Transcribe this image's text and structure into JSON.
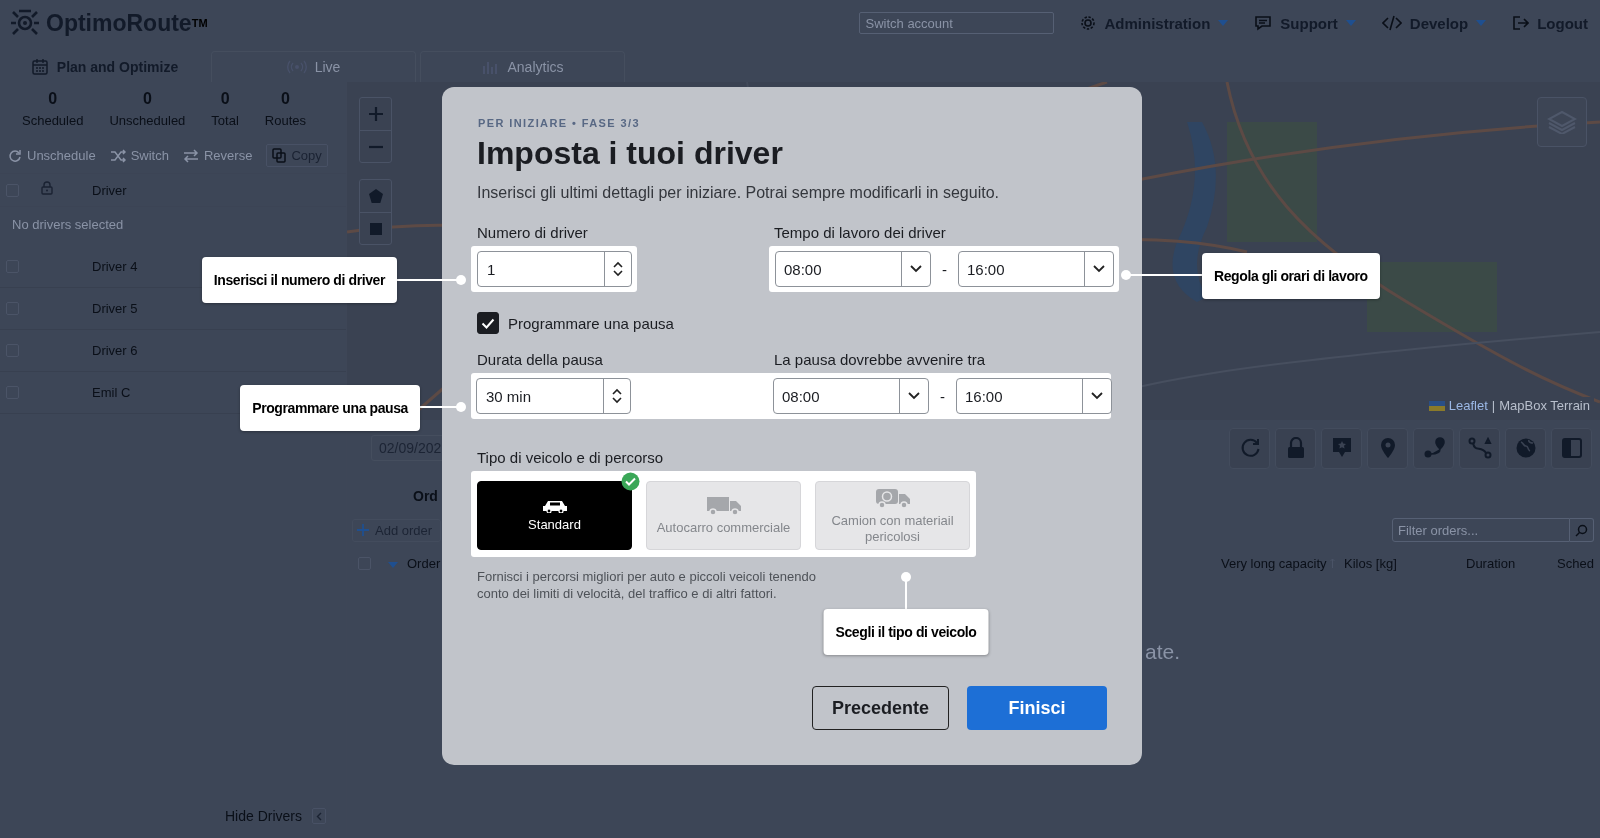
{
  "app": {
    "logo": "OptimoRoute",
    "trademark": "TM",
    "switch_account": {
      "placeholder": "Switch account"
    },
    "nav": [
      {
        "label": "Administration",
        "dropdown": true
      },
      {
        "label": "Support",
        "dropdown": true
      },
      {
        "label": "Develop",
        "dropdown": true
      },
      {
        "label": "Logout",
        "dropdown": false
      }
    ]
  },
  "tabs": [
    {
      "label": "Plan and Optimize",
      "selected": true
    },
    {
      "label": "Live",
      "selected": false
    },
    {
      "label": "Analytics",
      "selected": false
    }
  ],
  "stats": [
    {
      "value": "0",
      "label": "Scheduled"
    },
    {
      "value": "0",
      "label": "Unscheduled"
    },
    {
      "value": "0",
      "label": "Total"
    },
    {
      "value": "0",
      "label": "Routes"
    }
  ],
  "toolbar": [
    {
      "label": "Unschedule",
      "disabled": true
    },
    {
      "label": "Switch",
      "disabled": true
    },
    {
      "label": "Reverse",
      "disabled": true
    },
    {
      "label": "Copy",
      "disabled": false
    }
  ],
  "drivers": {
    "column": "Driver",
    "select_all_checked": false,
    "empty_message": "No drivers selected",
    "rows": [
      {
        "name": "Driver 4",
        "checked": false
      },
      {
        "name": "Driver 5",
        "checked": false
      },
      {
        "name": "Driver 6",
        "checked": false
      },
      {
        "name": "Emil C",
        "checked": false
      }
    ],
    "hide_label": "Hide Drivers"
  },
  "map": {
    "attribution_link": "Leaflet",
    "attribution_separator": "|",
    "attribution_text": "MapBox Terrain"
  },
  "orders": {
    "date": "02/09/202",
    "title": "Ord",
    "add_button": "Add order",
    "filter": {
      "placeholder": "Filter orders..."
    },
    "select_all_checked": false,
    "columns": [
      "Order",
      "Very long capacity",
      "Kilos [kg]",
      "Duration",
      "Sched"
    ],
    "empty_text": "ate."
  },
  "dialog": {
    "step": "PER INIZIARE • FASE 3/3",
    "title": "Imposta i tuoi driver",
    "subtitle": "Inserisci gli ultimi dettagli per iniziare. Potrai sempre modificarli in seguito.",
    "driver_count": {
      "label": "Numero di driver",
      "value": "1"
    },
    "work_time": {
      "label": "Tempo di lavoro dei driver",
      "from": "08:00",
      "separator": "-",
      "to": "16:00"
    },
    "break_option": {
      "label": "Programmare una pausa",
      "checked": true
    },
    "break_duration": {
      "label": "Durata della pausa",
      "value": "30 min"
    },
    "break_window": {
      "label": "La pausa dovrebbe avvenire tra",
      "from": "08:00",
      "separator": "-",
      "to": "16:00"
    },
    "vehicle": {
      "label": "Tipo di veicolo e di percorso",
      "options": [
        {
          "label": "Standard",
          "selected": true
        },
        {
          "label": "Autocarro commerciale",
          "selected": false
        },
        {
          "label": "Camion con materiail pericolosi",
          "selected": false
        }
      ],
      "description": "Fornisci i percorsi migliori per auto e piccoli veicoli tenendo conto dei limiti di velocità, del traffico e di altri fattori."
    },
    "buttons": [
      {
        "label": "Precedente",
        "kind": "secondary"
      },
      {
        "label": "Finisci",
        "kind": "primary"
      }
    ]
  },
  "callouts": [
    {
      "text": "Inserisci il numero di driver"
    },
    {
      "text": "Regola gli orari di lavoro"
    },
    {
      "text": "Programmare una pausa"
    },
    {
      "text": "Scegli il tipo di veicolo"
    }
  ]
}
